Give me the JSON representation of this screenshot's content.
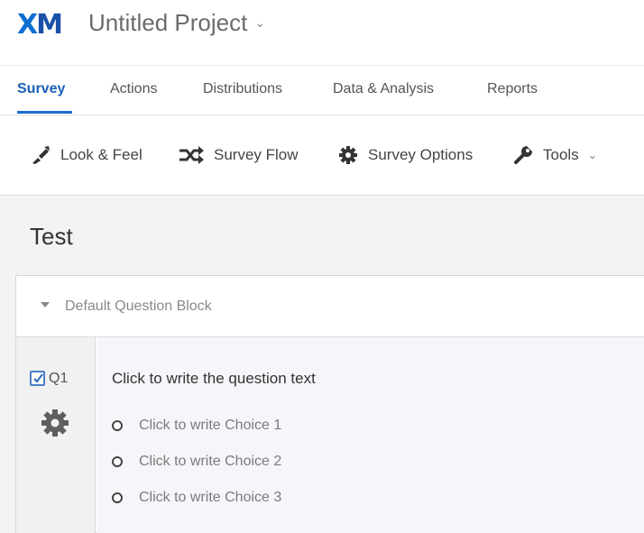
{
  "header": {
    "logo_x": "X",
    "logo_m": "M",
    "project_title": "Untitled Project",
    "project_caret": "⌄"
  },
  "tabs": [
    {
      "label": "Survey",
      "active": true
    },
    {
      "label": "Actions"
    },
    {
      "label": "Distributions"
    },
    {
      "label": "Data & Analysis"
    },
    {
      "label": "Reports"
    }
  ],
  "toolbar": {
    "look_feel": "Look & Feel",
    "survey_flow": "Survey Flow",
    "survey_options": "Survey Options",
    "tools": "Tools",
    "tools_caret": "⌄"
  },
  "survey": {
    "name": "Test",
    "block": {
      "title": "Default Question Block",
      "question": {
        "number": "Q1",
        "checked": true,
        "text": "Click to write the question text",
        "choices": [
          "Click to write Choice 1",
          "Click to write Choice 2",
          "Click to write Choice 3"
        ]
      }
    }
  },
  "colors": {
    "brand_blue": "#0b6ed0",
    "active_tab": "#1b5fb8",
    "canvas_bg": "#f3f3f3"
  }
}
